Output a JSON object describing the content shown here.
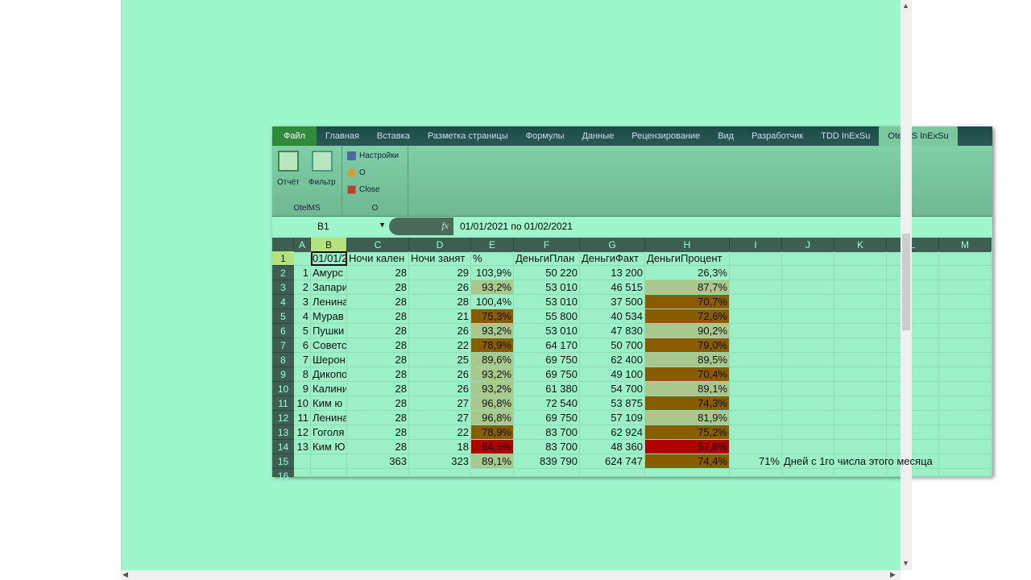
{
  "ribbon": {
    "tabs": [
      "Файл",
      "Главная",
      "Вставка",
      "Разметка страницы",
      "Формулы",
      "Данные",
      "Рецензирование",
      "Вид",
      "Разработчик",
      "TDD InExSu",
      "OtelMS InExSu"
    ],
    "active_tab": "OtelMS InExSu",
    "group1": {
      "label": "OtelMS",
      "report": "Отчёт",
      "filter": "Фильтр"
    },
    "group2": {
      "label": "O",
      "settings": "Настройки",
      "o": "O",
      "close": "Close"
    }
  },
  "formula_bar": {
    "name_box": "B1",
    "value": "01/01/2021 по 01/02/2021"
  },
  "columns": [
    "A",
    "B",
    "C",
    "D",
    "E",
    "F",
    "G",
    "H",
    "I",
    "J",
    "K",
    "L",
    "M"
  ],
  "selected_column": "B",
  "header_row": [
    "",
    "01/01/2021 по 01/02/2021",
    "Ночи кален",
    "Ночи занят",
    "%",
    "ДеньгиПлан",
    "ДеньгиФакт",
    "ДеньгиПроцент"
  ],
  "rows": [
    [
      "1",
      "Амурс",
      "28",
      "29",
      "103,9%",
      "50 220",
      "13 200",
      "26,3%"
    ],
    [
      "2",
      "Запари",
      "28",
      "26",
      "93,2%",
      "53 010",
      "46 515",
      "87,7%"
    ],
    [
      "3",
      "Ленина",
      "28",
      "28",
      "100,4%",
      "53 010",
      "37 500",
      "70,7%"
    ],
    [
      "4",
      "Мурав",
      "28",
      "21",
      "75,3%",
      "55 800",
      "40 534",
      "72,6%"
    ],
    [
      "5",
      "Пушки",
      "28",
      "26",
      "93,2%",
      "53 010",
      "47 830",
      "90,2%"
    ],
    [
      "6",
      "Советс",
      "28",
      "22",
      "78,9%",
      "64 170",
      "50 700",
      "79,0%"
    ],
    [
      "7",
      "Шерон",
      "28",
      "25",
      "89,6%",
      "69 750",
      "62 400",
      "89,5%"
    ],
    [
      "8",
      "Дикопо",
      "28",
      "26",
      "93,2%",
      "69 750",
      "49 100",
      "70,4%"
    ],
    [
      "9",
      "Калини",
      "28",
      "26",
      "93,2%",
      "61 380",
      "54 700",
      "89,1%"
    ],
    [
      "10",
      "Ким ю",
      "28",
      "27",
      "96,8%",
      "72 540",
      "53 875",
      "74,3%"
    ],
    [
      "11",
      "Ленина",
      "28",
      "27",
      "96,8%",
      "69 750",
      "57 109",
      "81,9%"
    ],
    [
      "12",
      "Гоголя",
      "28",
      "22",
      "78,9%",
      "83 700",
      "62 924",
      "75,2%"
    ],
    [
      "13",
      "Ким Ю",
      "28",
      "18",
      "64,5%",
      "83 700",
      "48 360",
      "57,8%"
    ]
  ],
  "e_fill": [
    "none",
    "light",
    "none",
    "brown",
    "light",
    "brown",
    "light",
    "light",
    "light",
    "light",
    "light",
    "brown",
    "red",
    "light"
  ],
  "h_fill": [
    "none",
    "light",
    "brown",
    "brown",
    "light",
    "brown",
    "light",
    "brown",
    "light",
    "brown",
    "light",
    "brown",
    "red",
    "brown"
  ],
  "totals": {
    "c": "363",
    "d": "323",
    "e": "89,1%",
    "f": "839 790",
    "g": "624 747",
    "h": "74,4%",
    "i": "71%",
    "j": "Дней с 1го числа этого месяца"
  },
  "colors": {
    "light": "#a8c88e",
    "brown": "#8a5c00",
    "red": "#b00000"
  }
}
